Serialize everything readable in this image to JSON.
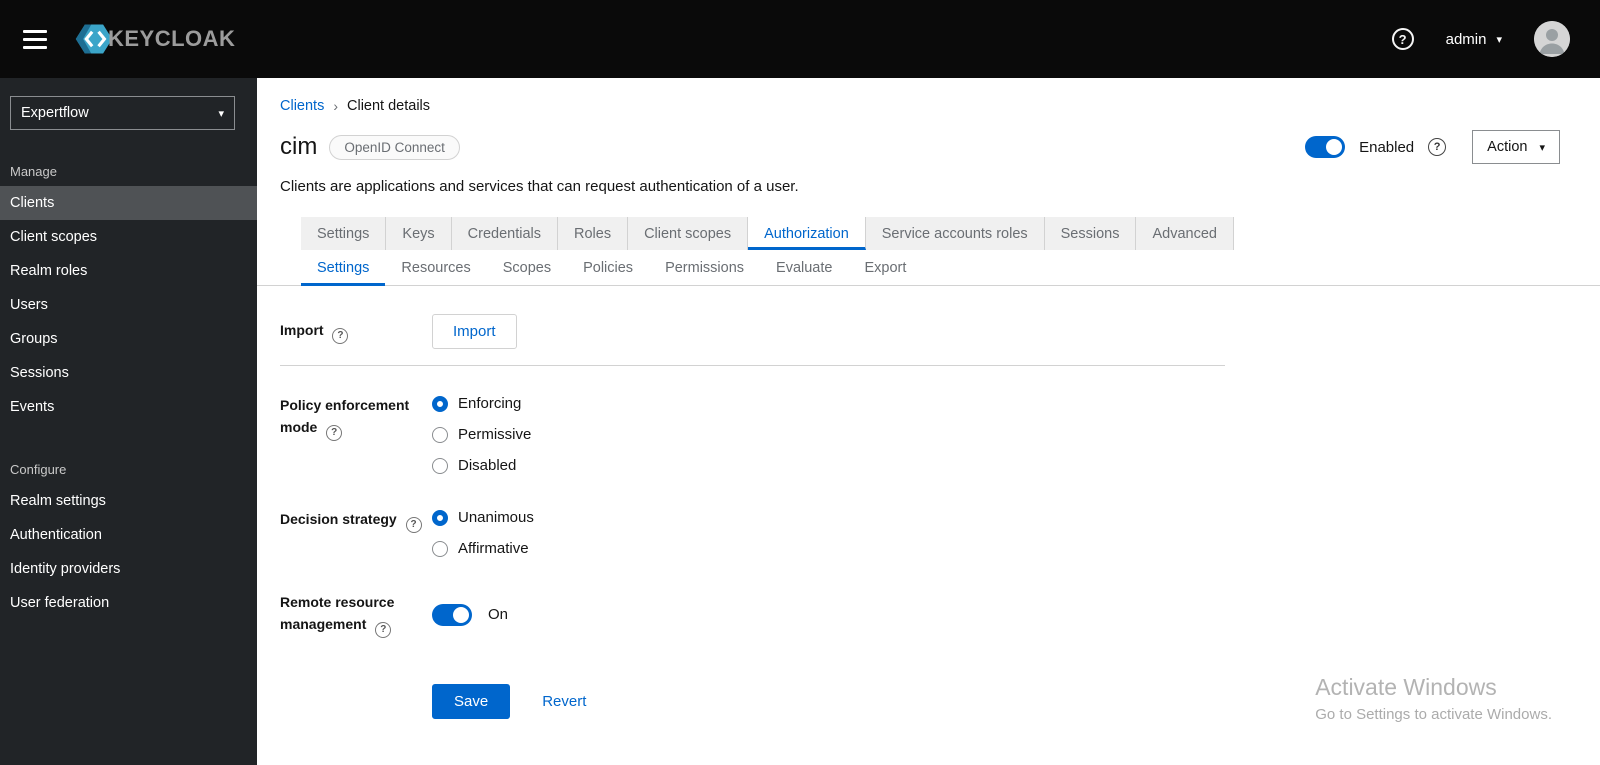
{
  "topbar": {
    "brand": "KEYCLOAK",
    "user": "admin"
  },
  "icons": {
    "help": "?",
    "caret_down": "▾",
    "breadcrumb_separator": "›"
  },
  "sidebar": {
    "realm": "Expertflow",
    "manage": {
      "label": "Manage",
      "items": [
        {
          "label": "Clients",
          "active": true
        },
        {
          "label": "Client scopes",
          "active": false
        },
        {
          "label": "Realm roles",
          "active": false
        },
        {
          "label": "Users",
          "active": false
        },
        {
          "label": "Groups",
          "active": false
        },
        {
          "label": "Sessions",
          "active": false
        },
        {
          "label": "Events",
          "active": false
        }
      ]
    },
    "configure": {
      "label": "Configure",
      "items": [
        {
          "label": "Realm settings",
          "active": false
        },
        {
          "label": "Authentication",
          "active": false
        },
        {
          "label": "Identity providers",
          "active": false
        },
        {
          "label": "User federation",
          "active": false
        }
      ]
    }
  },
  "main": {
    "breadcrumb": {
      "parent": "Clients",
      "current": "Client details"
    },
    "header": {
      "title": "cim",
      "badge": "OpenID Connect",
      "description": "Clients are applications and services that can request authentication of a user.",
      "enabled_label": "Enabled",
      "enabled": true,
      "action_label": "Action"
    },
    "tabs": [
      "Settings",
      "Keys",
      "Credentials",
      "Roles",
      "Client scopes",
      "Authorization",
      "Service accounts roles",
      "Sessions",
      "Advanced"
    ],
    "active_tab": "Authorization",
    "subtabs": [
      "Settings",
      "Resources",
      "Scopes",
      "Policies",
      "Permissions",
      "Evaluate",
      "Export"
    ],
    "active_subtab": "Settings",
    "form": {
      "import": {
        "label": "Import",
        "button": "Import"
      },
      "policy": {
        "label": "Policy enforcement mode",
        "options": [
          "Enforcing",
          "Permissive",
          "Disabled"
        ],
        "selected": "Enforcing"
      },
      "decision": {
        "label": "Decision strategy",
        "options": [
          "Unanimous",
          "Affirmative"
        ],
        "selected": "Unanimous"
      },
      "remote": {
        "label": "Remote resource management",
        "state": "On",
        "enabled": true
      },
      "save": "Save",
      "revert": "Revert"
    }
  },
  "watermark": {
    "title": "Activate Windows",
    "subtitle": "Go to Settings to activate Windows."
  },
  "colors": {
    "accent": "#0066cc",
    "topbar_bg": "#0a0a0a",
    "sidebar_bg": "#212427",
    "sidebar_active_bg": "#4f5255",
    "tab_inactive_bg": "#f0f0f0"
  }
}
